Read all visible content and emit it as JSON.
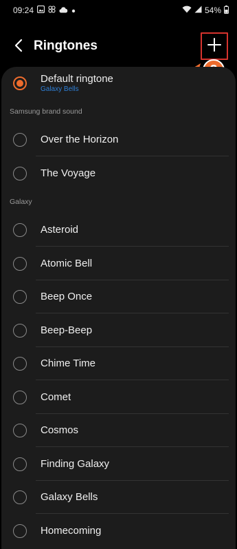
{
  "status_bar": {
    "time": "09:24",
    "battery": "54%",
    "left_icons": [
      "gallery-icon",
      "pinwheel-icon",
      "cloud-icon",
      "dot-icon"
    ],
    "right_icons": [
      "wifi-icon",
      "signal-icon",
      "battery-icon"
    ]
  },
  "header": {
    "title": "Ringtones",
    "back_icon": "chevron-left-icon",
    "add_icon": "plus-icon"
  },
  "annotation": {
    "step_number": "2",
    "highlight_color": "#d6332e",
    "badge_color": "#ee6c2d"
  },
  "default_ringtone": {
    "label": "Default ringtone",
    "value": "Galaxy Bells",
    "selected": true
  },
  "sections": [
    {
      "title": "Samsung brand sound",
      "items": [
        "Over the Horizon",
        "The Voyage"
      ]
    },
    {
      "title": "Galaxy",
      "items": [
        "Asteroid",
        "Atomic Bell",
        "Beep Once",
        "Beep-Beep",
        "Chime Time",
        "Comet",
        "Cosmos",
        "Finding Galaxy",
        "Galaxy Bells",
        "Homecoming"
      ]
    }
  ],
  "colors": {
    "accent": "#ee6c2d",
    "link": "#2e7fd6",
    "background": "#000000",
    "card": "#1c1c1c"
  }
}
